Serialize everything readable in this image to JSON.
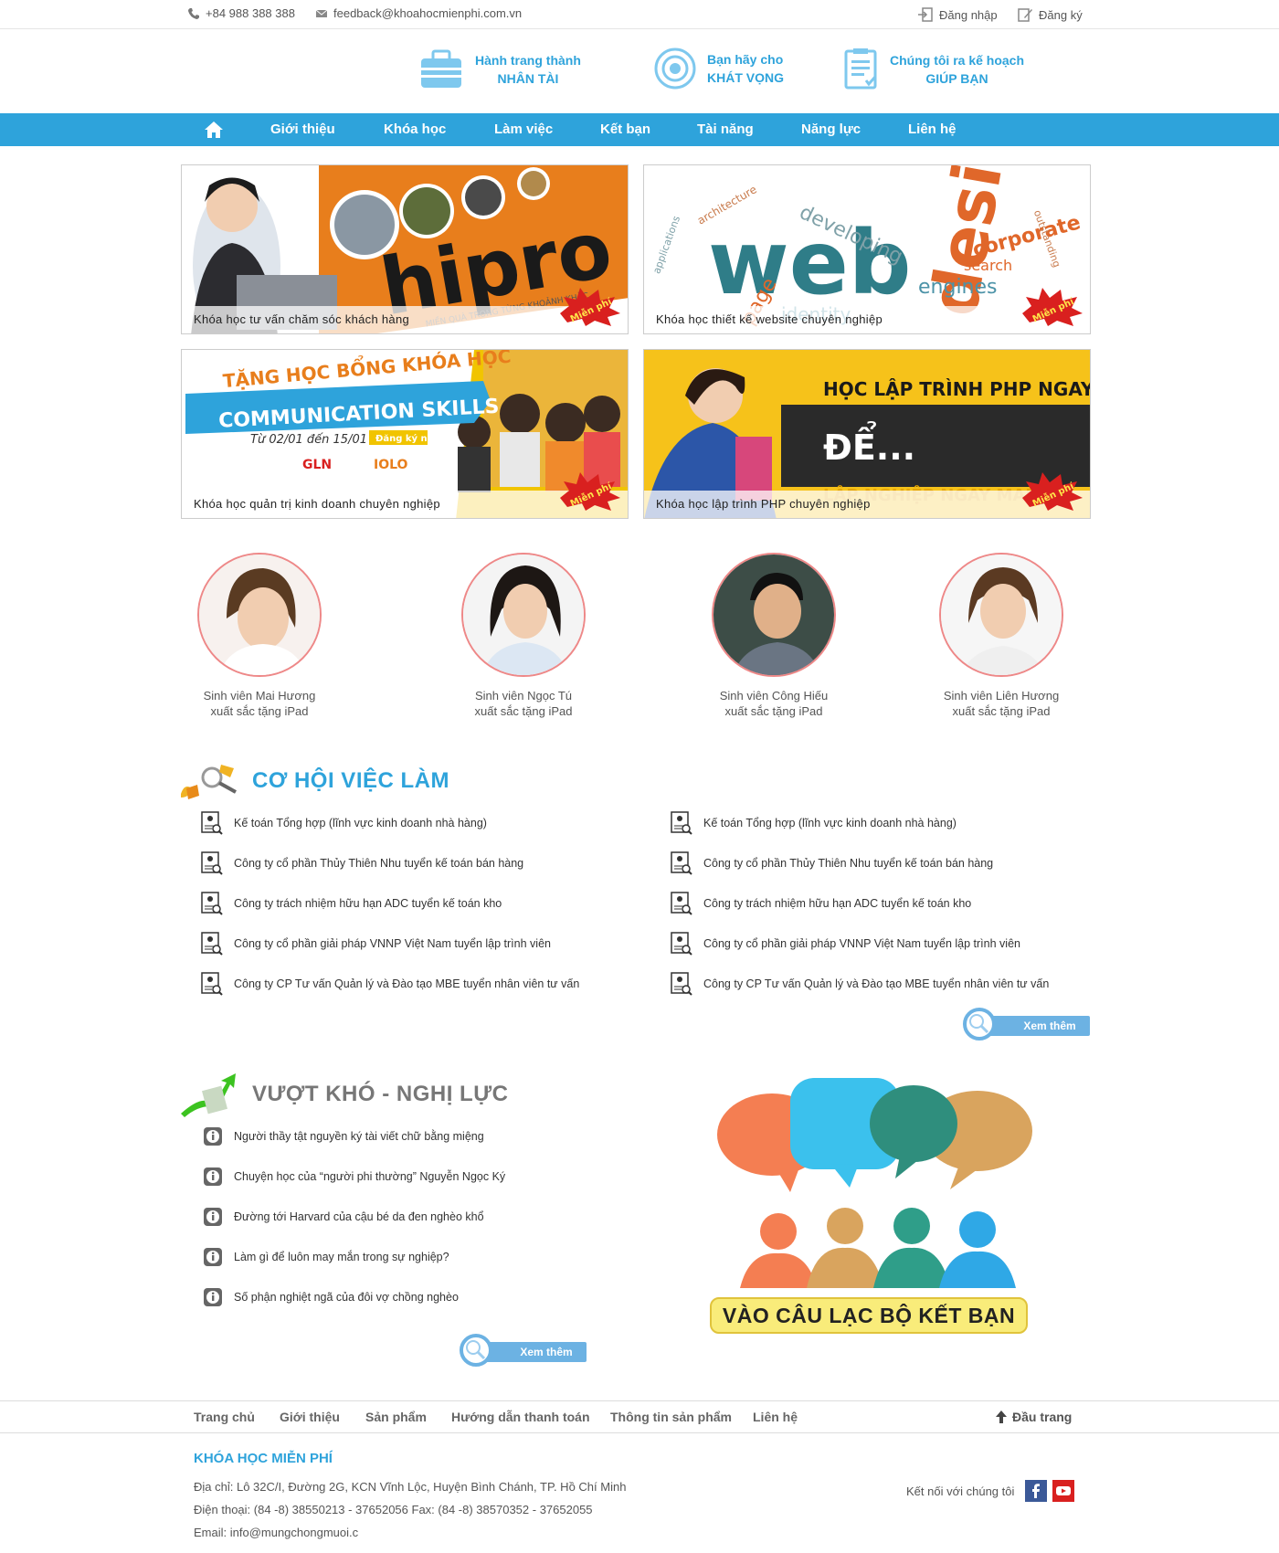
{
  "topbar": {
    "phone": "+84 988 388 388",
    "email": "feedback@khoahocmienphi.com.vn",
    "login": "Đăng nhập",
    "register": "Đăng ký"
  },
  "features": [
    {
      "line1": "Hành trang thành",
      "line2": "NHÂN TÀI",
      "icon": "suitcase-icon"
    },
    {
      "line1": "Bạn hãy cho",
      "line2": "KHÁT VỌNG",
      "icon": "target-icon"
    },
    {
      "line1": "Chúng tôi ra kế hoạch",
      "line2": "GIÚP BẠN",
      "icon": "clipboard-icon"
    }
  ],
  "nav": {
    "items": [
      "Giới thiệu",
      "Khóa học",
      "Làm việc",
      "Kết bạn",
      "Tài năng",
      "Năng lực",
      "Liên hệ"
    ]
  },
  "banners": [
    {
      "caption": "Khóa học tư vấn chăm sóc khách hàng",
      "badge": "Miễn phí",
      "art": "hipro",
      "art_sub": "MIỀN QUÀ TRONG TỪNG KHOẢNH KHẮC"
    },
    {
      "caption": "Khóa học thiết kế website chuyên nghiệp",
      "badge": "Miễn phí",
      "art": "web design"
    },
    {
      "caption": "Khóa học quản trị kinh doanh chuyên nghiệp",
      "badge": "Miễn phí",
      "art_title": "TẶNG HỌC BỔNG KHÓA HỌC",
      "art_main": "COMMUNICATION SKILLS",
      "art_date": "Từ 02/01 đến 15/01",
      "art_btn": "Đăng ký ngay",
      "art_logo1": "GLN",
      "art_logo2": "IOLO"
    },
    {
      "caption": "Khóa học lập trình PHP chuyên nghiệp",
      "badge": "Miễn phí",
      "art_title": "HỌC LẬP TRÌNH PHP NGAY HÔM NAY",
      "art_mid": "ĐỂ...",
      "art_bottom": "LẬP NGHIỆP NGAY MAI"
    }
  ],
  "students": [
    {
      "line1": "Sinh viên Mai Hương",
      "line2": "xuất sắc tặng iPad"
    },
    {
      "line1": "Sinh viên Ngọc Tú",
      "line2": "xuất sắc tặng iPad"
    },
    {
      "line1": "Sinh viên Công Hiếu",
      "line2": "xuất sắc tặng iPad"
    },
    {
      "line1": "Sinh viên Liên Hương",
      "line2": "xuất sắc tặng iPad"
    }
  ],
  "jobs": {
    "title": "CƠ HỘI VIỆC LÀM",
    "left": [
      "Kế toán Tổng hợp (lĩnh vực kinh doanh nhà hàng)",
      "Công ty cổ phần Thủy Thiên Nhu tuyển kế toán bán hàng",
      "Công ty trách nhiệm hữu hạn ADC tuyển kế toán kho",
      "Công ty cổ phần giải pháp VNNP Việt Nam tuyển lập trình viên",
      "Công ty CP Tư vấn Quản lý và Đào tạo MBE tuyển nhân viên tư vấn"
    ],
    "right": [
      "Kế toán Tổng hợp (lĩnh vực kinh doanh nhà hàng)",
      "Công ty cổ phần Thủy Thiên Nhu tuyển kế toán bán hàng",
      "Công ty trách nhiệm hữu hạn ADC tuyển kế toán kho",
      "Công ty cổ phần giải pháp VNNP Việt Nam tuyển lập trình viên",
      "Công ty CP Tư vấn Quản lý và Đào tạo MBE tuyển nhân viên tư vấn"
    ],
    "more": "Xem thêm"
  },
  "hardship": {
    "title": "VƯỢT KHÓ - NGHỊ LỰC",
    "items": [
      "Người thầy tật nguyền ký tài viết chữ bằng miệng",
      "Chuyện học của “người phi thường” Nguyễn Ngọc Ký",
      "Đường tới Harvard của cậu bé da đen nghèo khổ",
      "Làm gì để luôn may mắn trong sự nghiệp?",
      "Số phận nghiệt ngã của đôi vợ chồng nghèo"
    ],
    "more": "Xem thêm"
  },
  "club": {
    "button": "VÀO CÂU LẠC BỘ KẾT BẠN"
  },
  "footer_nav": {
    "items": [
      "Trang chủ",
      "Giới thiệu",
      "Sản phẩm",
      "Hướng dẫn thanh toán",
      "Thông tin sản phẩm",
      "Liên hệ"
    ],
    "top": "Đầu trang"
  },
  "footer": {
    "title": "KHÓA HỌC MIỄN PHÍ",
    "address": "Địa chỉ: Lô 32C/I, Đường 2G, KCN Vĩnh Lộc, Huyện Bình Chánh, TP. Hồ Chí Minh",
    "phone": "Điện thoại: (84 -8) 38550213 - 37652056 Fax: (84 -8) 38570352 - 37652055",
    "email": "Email: info@mungchongmuoi.c",
    "connect": "Kết nối với chúng tôi"
  },
  "colors": {
    "accent": "#2ea3db",
    "orange": "#e87e1c",
    "badge_red": "#d9201f"
  }
}
